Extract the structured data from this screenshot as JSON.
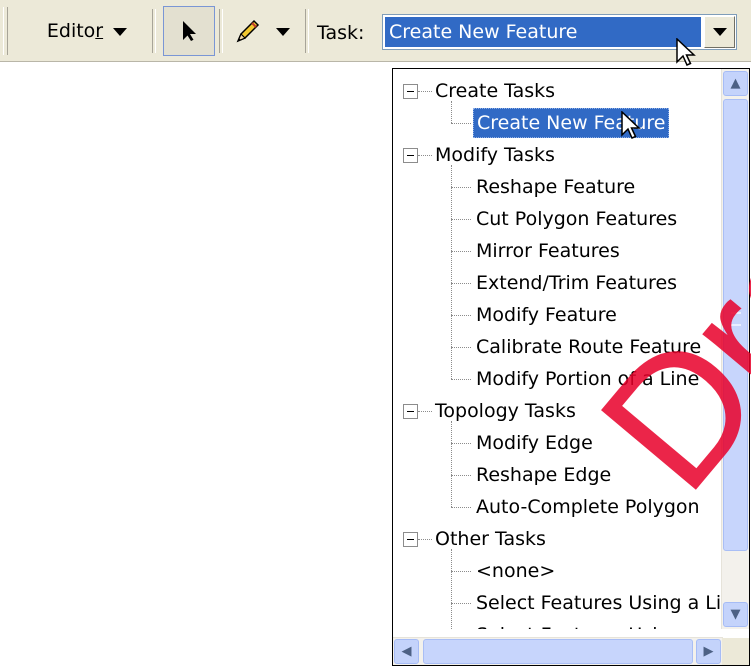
{
  "toolbar": {
    "editor_label_prefix": "Edito",
    "editor_label_underlined": "r",
    "task_label": "Task:",
    "task_value": "Create New Feature"
  },
  "dropdown": {
    "groups": [
      {
        "label": "Create Tasks",
        "items": [
          "Create New Feature"
        ]
      },
      {
        "label": "Modify Tasks",
        "items": [
          "Reshape Feature",
          "Cut Polygon Features",
          "Mirror Features",
          "Extend/Trim Features",
          "Modify Feature",
          "Calibrate Route Feature",
          "Modify Portion of a Line"
        ]
      },
      {
        "label": "Topology Tasks",
        "items": [
          "Modify Edge",
          "Reshape Edge",
          "Auto-Complete Polygon"
        ]
      },
      {
        "label": "Other Tasks",
        "items": [
          "<none>",
          "Select Features Using a Lir",
          "Select Features Using an A"
        ]
      }
    ],
    "selected_item": "Create New Feature"
  },
  "scroll": {
    "up_glyph": "▲",
    "down_glyph": "▼",
    "left_glyph": "◀",
    "right_glyph": "▶"
  },
  "watermark": "Draft",
  "colors": {
    "selection": "#316ac5",
    "toolbar_bg": "#ece9d8",
    "watermark": "#e8002a"
  }
}
